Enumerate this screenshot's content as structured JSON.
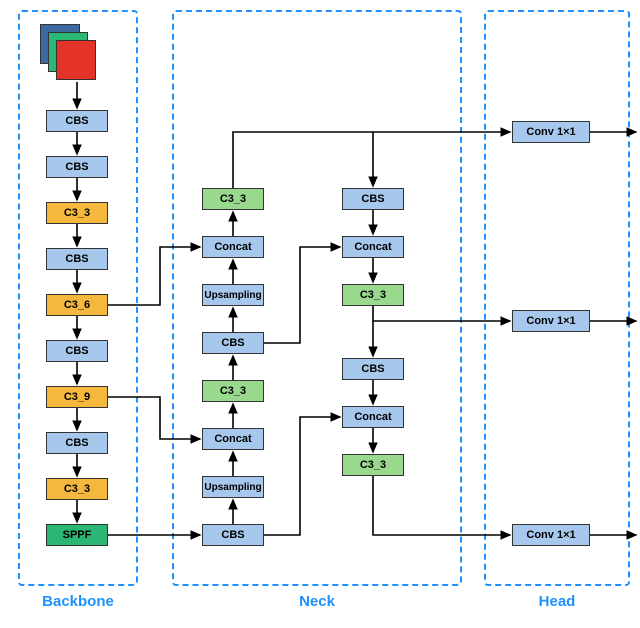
{
  "sections": {
    "backbone": "Backbone",
    "neck": "Neck",
    "head": "Head"
  },
  "nodes": {
    "bb_cbs1": "CBS",
    "bb_cbs2": "CBS",
    "bb_c3_3a": "C3_3",
    "bb_cbs3": "CBS",
    "bb_c3_6": "C3_6",
    "bb_cbs4": "CBS",
    "bb_c3_9": "C3_9",
    "bb_cbs5": "CBS",
    "bb_c3_3b": "C3_3",
    "bb_sppf": "SPPF",
    "nk_cbs_bot": "CBS",
    "nk_ups_bot": "Upsampling",
    "nk_concat_bot": "Concat",
    "nk_c3_mid": "C3_3",
    "nk_cbs_mid": "CBS",
    "nk_ups_mid": "Upsampling",
    "nk_concat_mid": "Concat",
    "nk_c3_top": "C3_3",
    "nk2_cbs_top": "CBS",
    "nk2_concat_top": "Concat",
    "nk2_c3_top": "C3_3",
    "nk2_cbs_bot": "CBS",
    "nk2_concat_bot": "Concat",
    "nk2_c3_bot": "C3_3",
    "hd_conv1": "Conv 1×1",
    "hd_conv2": "Conv 1×1",
    "hd_conv3": "Conv 1×1"
  },
  "colors": {
    "cbs": "#a6c8ec",
    "c3_yellow": "#f5b83d",
    "c3_green": "#98d98e",
    "sppf": "#2bb673",
    "dash": "#1e90ff",
    "stack_back": "#3c6aa0",
    "stack_mid": "#2bb673",
    "stack_front": "#e6332a"
  }
}
